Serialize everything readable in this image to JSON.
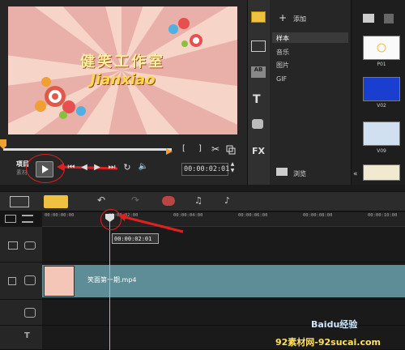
{
  "preview": {
    "video_title_cn": "健笑工作室",
    "video_title_en": "Jianxiao",
    "project_label": "项目",
    "clip_label": "素材",
    "timecode": "00:00:02:01"
  },
  "library": {
    "add_label": "添加",
    "items": [
      {
        "label": "样本"
      },
      {
        "label": "音乐"
      },
      {
        "label": "图片"
      },
      {
        "label": "GIF"
      }
    ],
    "browse_label": "浏览",
    "thumbs": [
      {
        "label": "P01"
      },
      {
        "label": "V02"
      },
      {
        "label": "V09"
      }
    ]
  },
  "timeline": {
    "ruler": [
      "00:00:00:00",
      "00:00:02:00",
      "00:00:04:00",
      "00:00:06:00",
      "00:00:08:00",
      "00:00:10:00"
    ],
    "playhead_time": "00:00:02:01",
    "clip_name": "笑面第一期.mp4"
  },
  "watermarks": {
    "baidu": "Baidu经验",
    "site": "92素材网-92sucai.com"
  },
  "colors": {
    "annotation": "#e02020",
    "clip": "#5e8d97",
    "accent": "#f0a030"
  }
}
